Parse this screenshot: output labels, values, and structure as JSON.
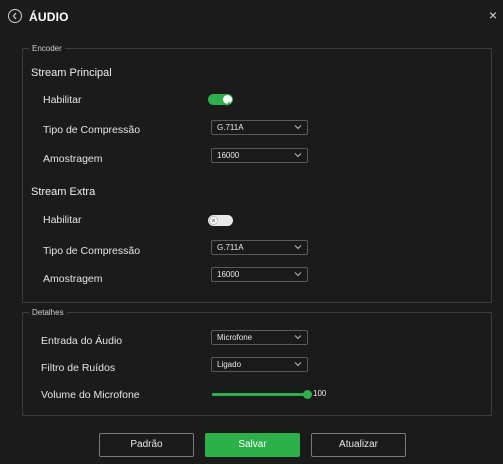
{
  "header": {
    "title": "ÁUDIO",
    "back_icon": "circle-chevron-left-icon",
    "close_label": "×"
  },
  "encoder": {
    "legend": "Encoder",
    "principal": {
      "title": "Stream Principal",
      "enable_label": "Habilitar",
      "enabled": true,
      "compression_label": "Tipo de Compressão",
      "compression_value": "G.711A",
      "sampling_label": "Amostragem",
      "sampling_value": "16000"
    },
    "extra": {
      "title": "Stream Extra",
      "enable_label": "Habilitar",
      "enabled": false,
      "compression_label": "Tipo de Compressão",
      "compression_value": "G.711A",
      "sampling_label": "Amostragem",
      "sampling_value": "16000"
    }
  },
  "details": {
    "legend": "Detalhes",
    "input_label": "Entrada do Áudio",
    "input_value": "Microfone",
    "noise_label": "Filtro de Ruídos",
    "noise_value": "Ligado",
    "volume_label": "Volume do Microfone",
    "volume_value": "100",
    "volume_fraction": 1.0
  },
  "buttons": {
    "default_label": "Padrão",
    "save_label": "Salvar",
    "refresh_label": "Atualizar"
  },
  "colors": {
    "accent": "#2bb04a",
    "background": "#1b1b1b",
    "border": "#3c3c3c"
  }
}
